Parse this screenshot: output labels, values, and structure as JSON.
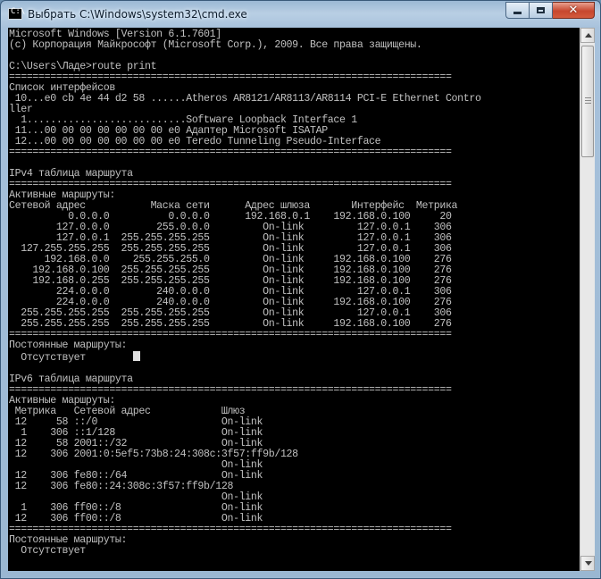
{
  "window": {
    "title": "Выбрать C:\\Windows\\system32\\cmd.exe",
    "icon": "cmd-icon",
    "icon_glyph": "C:\\"
  },
  "controls": {
    "minimize": "minimize-icon",
    "maximize": "maximize-icon",
    "close": "close-icon",
    "close_glyph": "✕"
  },
  "console": {
    "before_caret": "Microsoft Windows [Version 6.1.7601]\n(c) Корпорация Майкрософт (Microsoft Corp.), 2009. Все права защищены.\n\nC:\\Users\\Ладе>route print\n===========================================================================\nСписок интерфейсов\n 10...e0 cb 4e 44 d2 58 ......Atheros AR8121/AR8113/AR8114 PCI-E Ethernet Contro\nller\n  1...........................Software Loopback Interface 1\n 11...00 00 00 00 00 00 00 e0 Адаптер Microsoft ISATAP\n 12...00 00 00 00 00 00 00 e0 Teredo Tunneling Pseudo-Interface\n===========================================================================\n\nIPv4 таблица маршрута\n===========================================================================\nАктивные маршруты:\nСетевой адрес           Маска сети      Адрес шлюза       Интерфейс  Метрика\n          0.0.0.0          0.0.0.0      192.168.0.1    192.168.0.100     20\n        127.0.0.0        255.0.0.0         On-link         127.0.0.1    306\n        127.0.0.1  255.255.255.255         On-link         127.0.0.1    306\n  127.255.255.255  255.255.255.255         On-link         127.0.0.1    306\n      192.168.0.0    255.255.255.0         On-link     192.168.0.100    276\n    192.168.0.100  255.255.255.255         On-link     192.168.0.100    276\n    192.168.0.255  255.255.255.255         On-link     192.168.0.100    276\n        224.0.0.0        240.0.0.0         On-link         127.0.0.1    306\n        224.0.0.0        240.0.0.0         On-link     192.168.0.100    276\n  255.255.255.255  255.255.255.255         On-link         127.0.0.1    306\n  255.255.255.255  255.255.255.255         On-link     192.168.0.100    276\n===========================================================================\nПостоянные маршруты:\n  Отсутствует        ",
    "after_caret": "\n\nIPv6 таблица маршрута\n===========================================================================\nАктивные маршруты:\n Метрика   Сетевой адрес            Шлюз\n 12     58 ::/0                     On-link\n  1    306 ::1/128                  On-link\n 12     58 2001::/32                On-link\n 12    306 2001:0:5ef5:73b8:24:308c:3f57:ff9b/128\n                                    On-link\n 12    306 fe80::/64                On-link\n 12    306 fe80::24:308c:3f57:ff9b/128\n                                    On-link\n  1    306 ff00::/8                 On-link\n 12    306 ff00::/8                 On-link\n===========================================================================\nПостоянные маршруты:\n  Отсутствует"
  },
  "colors": {
    "console_bg": "#000000",
    "console_fg": "#c0c0c0",
    "caret": "#e0e0e0"
  }
}
